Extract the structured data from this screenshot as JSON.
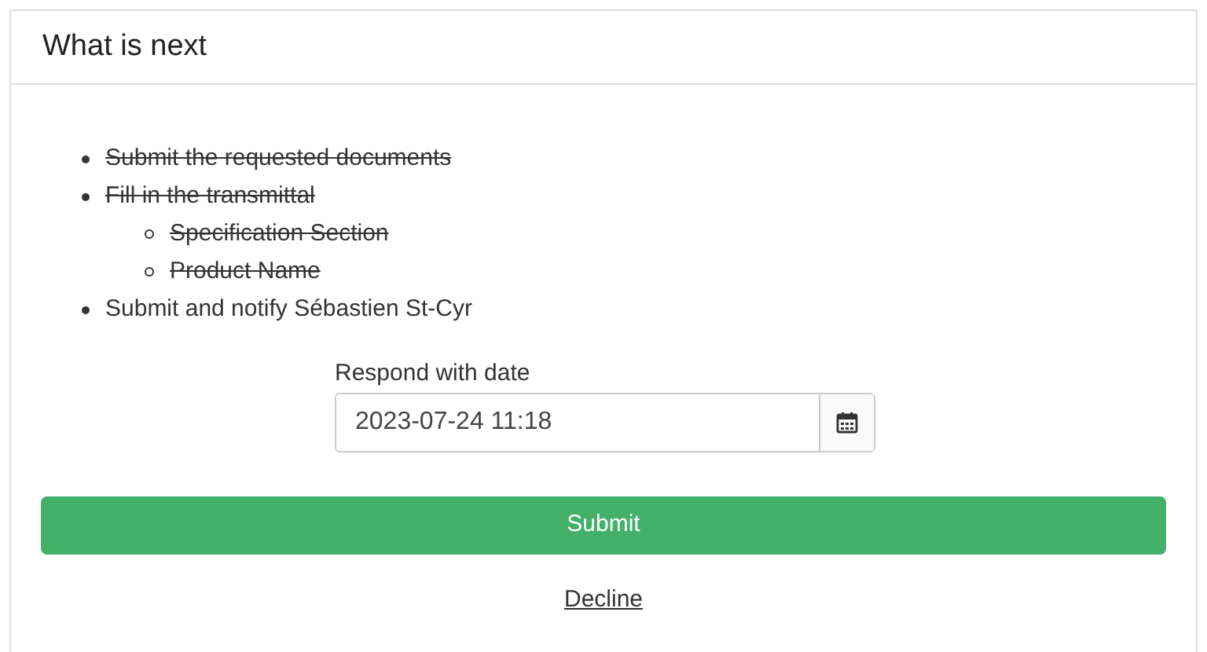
{
  "card": {
    "title": "What is next"
  },
  "tasks": [
    {
      "text": "Submit the requested documents",
      "done": true
    },
    {
      "text": "Fill in the transmittal",
      "done": true,
      "children": [
        {
          "text": "Specification Section",
          "done": true
        },
        {
          "text": "Product Name",
          "done": true
        }
      ]
    },
    {
      "text": "Submit and notify Sébastien St-Cyr",
      "done": false
    }
  ],
  "date_field": {
    "label": "Respond with date",
    "value": "2023-07-24 11:18"
  },
  "buttons": [
    {
      "kind": "primary",
      "label": "Submit"
    },
    {
      "kind": "link",
      "label": "Decline"
    }
  ]
}
